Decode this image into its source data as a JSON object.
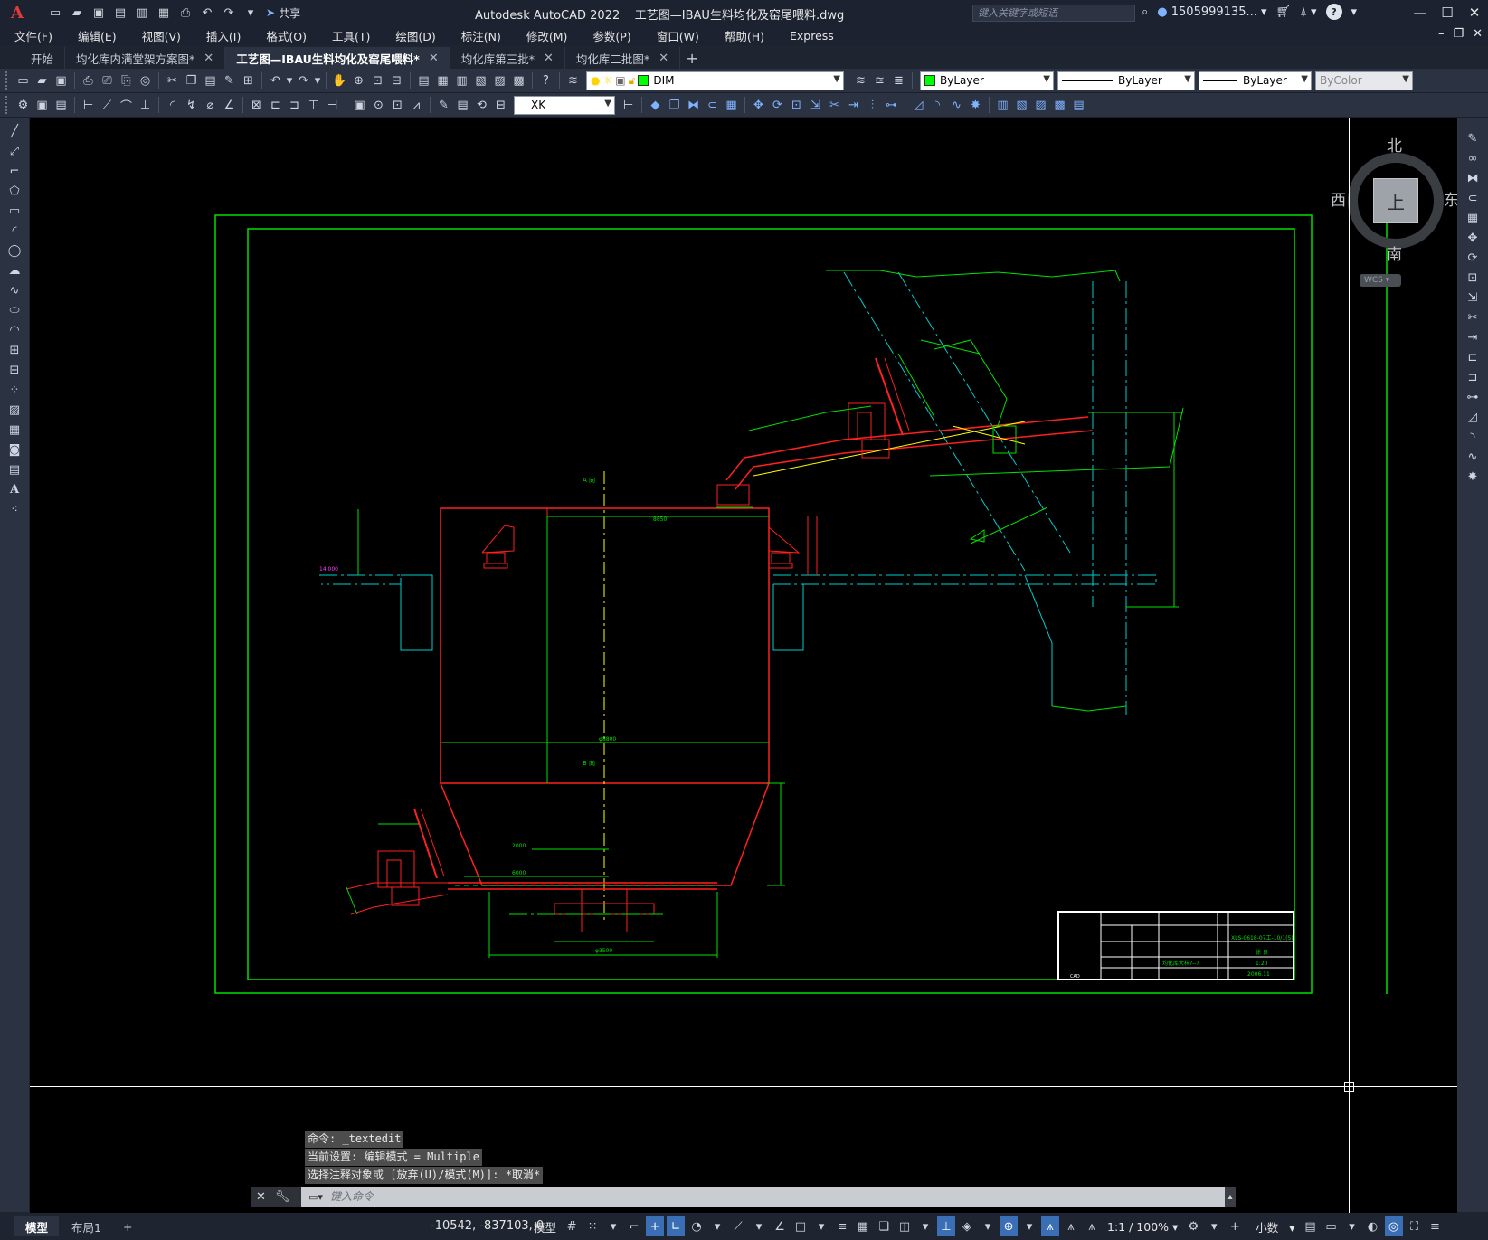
{
  "app": {
    "title": "Autodesk AutoCAD 2022",
    "filename": "工艺图—IBAU生料均化及窑尾喂料.dwg",
    "share_label": "共享",
    "search_placeholder": "键入关键字或短语",
    "user": "1505999135...",
    "help_label": "?"
  },
  "menu": [
    "文件(F)",
    "编辑(E)",
    "视图(V)",
    "插入(I)",
    "格式(O)",
    "工具(T)",
    "绘图(D)",
    "标注(N)",
    "修改(M)",
    "参数(P)",
    "窗口(W)",
    "帮助(H)",
    "Express"
  ],
  "tabs": [
    {
      "label": "开始",
      "active": false,
      "closable": false
    },
    {
      "label": "均化库内满堂架方案图*",
      "active": false,
      "closable": true
    },
    {
      "label": "工艺图—IBAU生料均化及窑尾喂料*",
      "active": true,
      "closable": true
    },
    {
      "label": "均化库第三批*",
      "active": false,
      "closable": true
    },
    {
      "label": "均化库二批图*",
      "active": false,
      "closable": true
    }
  ],
  "properties": {
    "layer": "DIM",
    "color": "ByLayer",
    "linetype": "ByLayer",
    "lineweight": "ByLayer",
    "plotstyle": "ByColor",
    "textstyle": "XK"
  },
  "viewcube": {
    "north": "北",
    "south": "南",
    "east": "东",
    "west": "西",
    "top": "上",
    "wcs": "WCS"
  },
  "command": {
    "history": [
      "命令: _textedit",
      "当前设置: 编辑模式 = Multiple",
      "选择注释对象或 [放弃(U)/模式(M)]: *取消*"
    ],
    "placeholder": "键入命令"
  },
  "status": {
    "layout_tabs": [
      "模型",
      "布局1"
    ],
    "coords": "-10542, -837103, 0",
    "model_label": "模型",
    "scale": "1:1 / 100%",
    "units": "小数"
  },
  "drawing": {
    "labels": {
      "a_label_top": "A 向",
      "b_label": "B 向",
      "dim_8850": "8850",
      "dim_p8800": "φ8800",
      "dim_2000": "2000",
      "dim_6000": "6000",
      "dim_p3500": "φ3500",
      "el_14": "14.000",
      "tb_scale": "1:20",
      "tb_date": "2006.11",
      "tb_title": "均化库大样?--?",
      "tb_code": "XLS-0618-07工-10/1(5)",
      "tb_author": "徐 良",
      "cad": "CAD"
    }
  }
}
